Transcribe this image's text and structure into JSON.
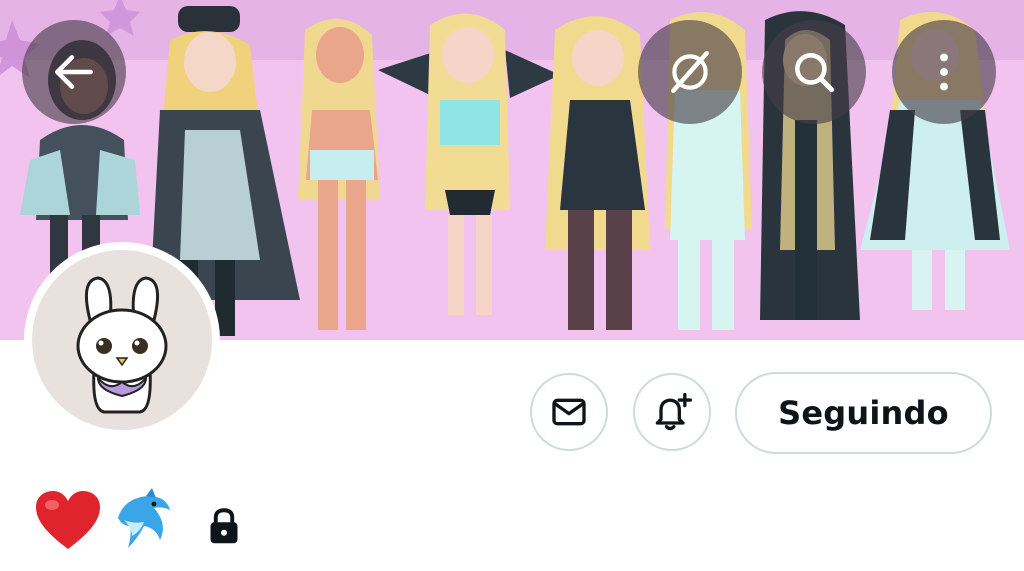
{
  "profile": {
    "display_name_emojis": [
      "heart",
      "dolphin"
    ],
    "protected_account": true,
    "follow_button_label": "Seguindo"
  },
  "top_bar": {
    "icons": [
      "back-arrow-icon",
      "grok-icon",
      "search-icon",
      "more-vertical-icon"
    ]
  },
  "actions": {
    "icons": [
      "mail-icon",
      "bell-plus-icon"
    ]
  },
  "colors": {
    "banner_bg": "#f4bff0",
    "overlay_btn": "#463e48",
    "button_border": "#cfd9de",
    "text_primary": "#0f1419",
    "heart": "#e0242e",
    "dolphin": "#3aa6e8"
  }
}
